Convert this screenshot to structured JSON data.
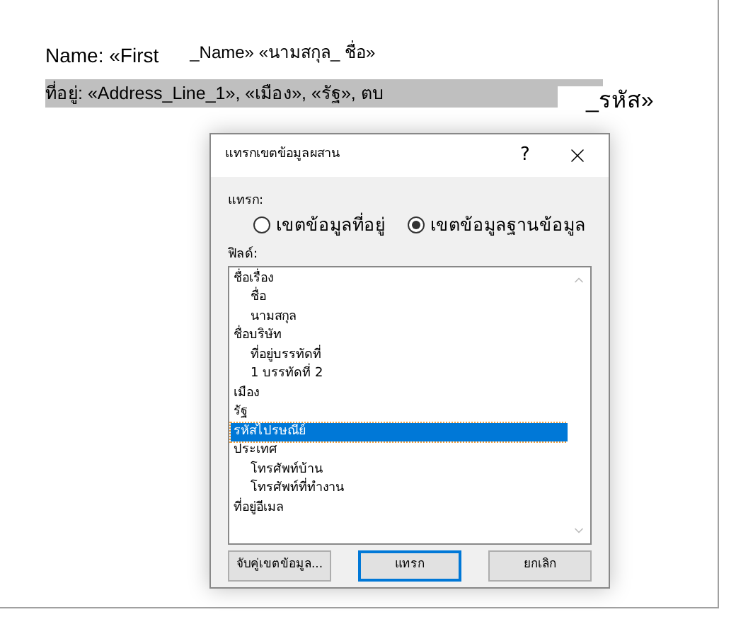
{
  "document": {
    "line_1": [
      "Name: «First",
      "_Name» «นามสกุล_ ชื่อ»"
    ],
    "line_2": [
      "ที่อยู่: «Address_Line_1», «เมือง», «รัฐ», ตบ",
      "_รหัส»"
    ]
  },
  "dialog": {
    "title": "แทรกเขตข้อมูลผสาน",
    "help": "?",
    "insert_label": "แทรก:",
    "options": [
      {
        "label": "เขตข้อมูลที่อยู่",
        "selected": false
      },
      {
        "label": "เขตข้อมูลฐานข้อมูล",
        "selected": true
      }
    ],
    "fields_label": "ฟิลด์:",
    "fields": [
      {
        "label": "ชื่อเรื่อง",
        "selected": false,
        "children": [
          {
            "label": "ชื่อ",
            "selected": false
          },
          {
            "label": "นามสกุล",
            "selected": false
          }
        ]
      },
      {
        "label": "ชื่อบริษัท",
        "selected": false,
        "children": [
          {
            "label": "ที่อยู่บรรทัดที่",
            "selected": false
          },
          {
            "label": "1 บรรทัดที่ 2",
            "selected": false
          }
        ]
      },
      {
        "label": "เมือง",
        "selected": false
      },
      {
        "label": "รัฐ",
        "selected": false
      },
      {
        "label": "รหัสไปรษณีย์",
        "selected": true
      },
      {
        "label": "ประเทศ",
        "selected": false,
        "children": [
          {
            "label": "โทรศัพท์บ้าน",
            "selected": false
          },
          {
            "label": "โทรศัพท์ที่ทำงาน",
            "selected": false
          }
        ]
      },
      {
        "label": "ที่อยู่อีเมล",
        "selected": false
      }
    ],
    "buttons": [
      {
        "label": "จับคู่เขตข้อมูล...",
        "kind": "normal"
      },
      {
        "label": "แทรก",
        "kind": "default"
      },
      {
        "label": "ยกเลิก",
        "kind": "normal"
      }
    ]
  }
}
